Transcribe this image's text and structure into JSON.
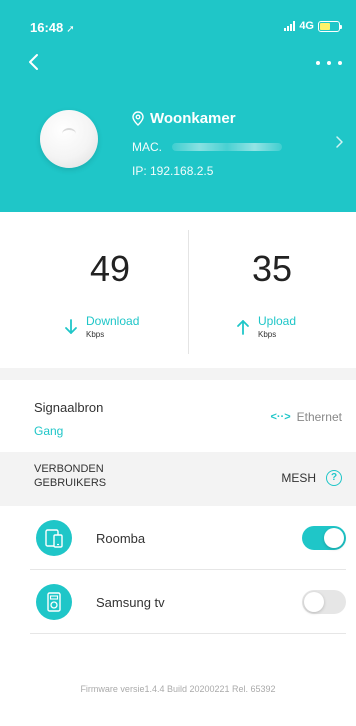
{
  "status": {
    "time": "16:48",
    "network": "4G"
  },
  "device": {
    "location": "Woonkamer",
    "mac_label": "MAC.",
    "ip": "IP: 192.168.2.5"
  },
  "stats": {
    "download": {
      "value": "49",
      "label": "Download",
      "unit": "Kbps"
    },
    "upload": {
      "value": "35",
      "label": "Upload",
      "unit": "Kbps"
    }
  },
  "signal_source": {
    "title": "Signaalbron",
    "value": "Gang",
    "connection": "Ethernet"
  },
  "connected_users": {
    "title": "VERBONDEN GEBRUIKERS",
    "mesh_label": "MESH",
    "clients": [
      {
        "name": "Roomba",
        "enabled": true,
        "icon": "tablet-phone-icon"
      },
      {
        "name": "Samsung tv",
        "enabled": false,
        "icon": "speaker-icon"
      }
    ]
  },
  "firmware": "Firmware versie1.4.4 Build 20200221 Rel. 65392",
  "colors": {
    "accent": "#1fc6c8",
    "battery": "#fff36b"
  }
}
